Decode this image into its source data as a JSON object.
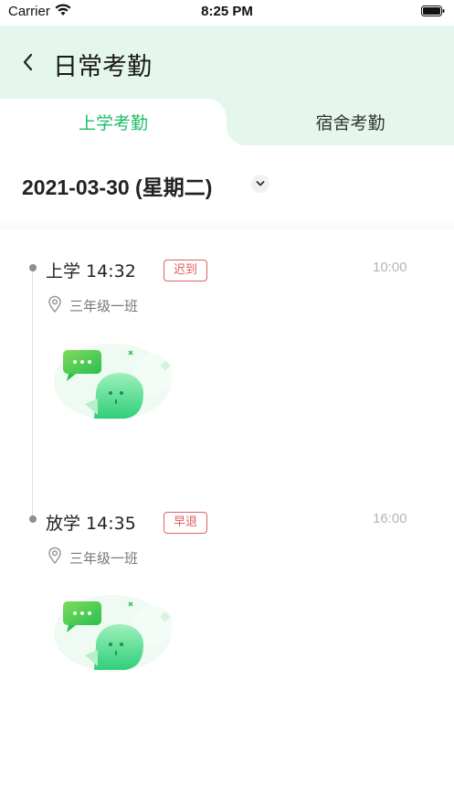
{
  "status_bar": {
    "carrier": "Carrier",
    "time": "8:25 PM"
  },
  "header": {
    "title": "日常考勤"
  },
  "tabs": [
    {
      "label": "上学考勤",
      "active": true
    },
    {
      "label": "宿舍考勤",
      "active": false
    }
  ],
  "date": {
    "text": "2021-03-30 (星期二)"
  },
  "records": [
    {
      "title": "上学 14:32",
      "badge": "迟到",
      "scheduled_time": "10:00",
      "location": "三年级一班"
    },
    {
      "title": "放学 14:35",
      "badge": "早退",
      "scheduled_time": "16:00",
      "location": "三年级一班"
    }
  ],
  "colors": {
    "accent": "#1fbd6a",
    "header_bg": "#e5f7ec",
    "badge": "#e06060"
  },
  "icons": [
    "back-chevron-icon",
    "dropdown-icon",
    "location-pin-icon",
    "wifi-icon",
    "battery-icon"
  ]
}
